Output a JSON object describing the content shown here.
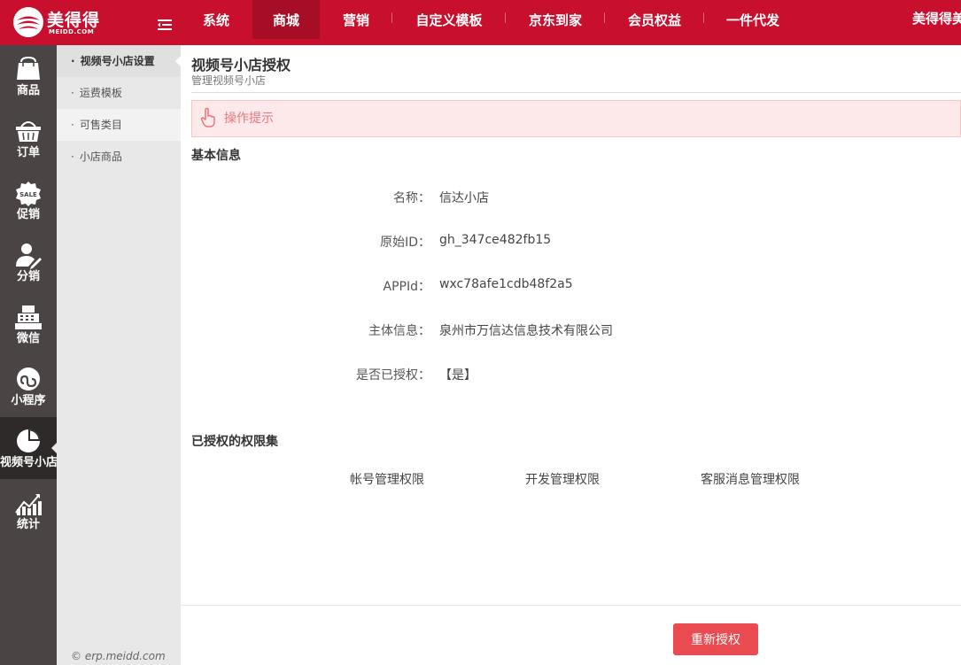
{
  "header": {
    "logo_text": "美得得",
    "logo_sub": "MEIDD.COM",
    "brand_right": "美得得美",
    "nav": [
      {
        "label": "系统",
        "width": 82,
        "active": false
      },
      {
        "label": "商城",
        "width": 76,
        "active": true
      },
      {
        "label": "营销",
        "width": 82,
        "active": false
      },
      {
        "label": "自定义模板",
        "width": 128,
        "active": false
      },
      {
        "label": "京东到家",
        "width": 112,
        "active": false
      },
      {
        "label": "会员权益",
        "width": 112,
        "active": false
      },
      {
        "label": "一件代发",
        "width": 110,
        "active": false
      }
    ]
  },
  "sidebar": {
    "items": [
      {
        "label": "商品",
        "icon": "bag-icon"
      },
      {
        "label": "订单",
        "icon": "basket-icon"
      },
      {
        "label": "促销",
        "icon": "sale-badge-icon"
      },
      {
        "label": "分销",
        "icon": "user-edit-icon"
      },
      {
        "label": "微信",
        "icon": "cash-register-icon"
      },
      {
        "label": "小程序",
        "icon": "miniprogram-icon"
      },
      {
        "label": "视频号小店",
        "icon": "pie-chart-icon",
        "active": true
      },
      {
        "label": "统计",
        "icon": "bar-chart-icon"
      }
    ]
  },
  "submenu": {
    "items": [
      {
        "label": "视频号小店设置",
        "active": true
      },
      {
        "label": "运费模板",
        "active": false
      },
      {
        "label": "可售类目",
        "active": false,
        "hover": true
      },
      {
        "label": "小店商品",
        "active": false
      }
    ],
    "copyright": "© erp.meidd.com"
  },
  "main": {
    "title": "视频号小店授权",
    "subtitle": "管理视频号小店",
    "tip": "操作提示",
    "basic_info_title": "基本信息",
    "fields": [
      {
        "label": "名称：",
        "value": "信达小店"
      },
      {
        "label": "原始ID：",
        "value": "gh_347ce482fb15"
      },
      {
        "label": "APPId：",
        "value": "wxc78afe1cdb48f2a5"
      },
      {
        "label": "主体信息：",
        "value": "泉州市万信达信息技术有限公司"
      },
      {
        "label": "是否已授权：",
        "value": "【是】"
      }
    ],
    "permissions_title": "已授权的权限集",
    "permissions": [
      "帐号管理权限",
      "开发管理权限",
      "客服消息管理权限"
    ],
    "reauth_button": "重新授权"
  }
}
